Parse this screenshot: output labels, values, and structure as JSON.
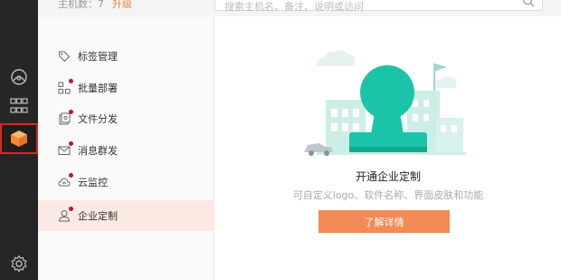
{
  "topbar": {
    "host_count": "主机数：7",
    "upgrade": "升级",
    "search_placeholder": "搜索主机名、备注、说明或访问"
  },
  "rail": {
    "items": [
      {
        "icon": "monitor-icon"
      },
      {
        "icon": "grid-icon"
      },
      {
        "icon": "box-icon",
        "active": true
      },
      {
        "icon": "gear-icon"
      }
    ],
    "active_color": "#e0261a"
  },
  "menu": {
    "items": [
      {
        "label": "标签管理",
        "icon": "tag-icon"
      },
      {
        "label": "批量部署",
        "icon": "batch-deploy-icon"
      },
      {
        "label": "文件分发",
        "icon": "file-distribute-icon"
      },
      {
        "label": "消息群发",
        "icon": "mail-icon"
      },
      {
        "label": "云监控",
        "icon": "cloud-icon"
      },
      {
        "label": "企业定制",
        "icon": "user-icon",
        "active": true
      }
    ]
  },
  "main": {
    "headline": "开通企业定制",
    "subline": "可自定义logo、软件名称、界面皮肤和功能",
    "cta_label": "了解详情"
  },
  "colors": {
    "accent": "#f28a55",
    "illustration": "#1bc4a8",
    "menu_active_bg": "#fbe9e3"
  }
}
